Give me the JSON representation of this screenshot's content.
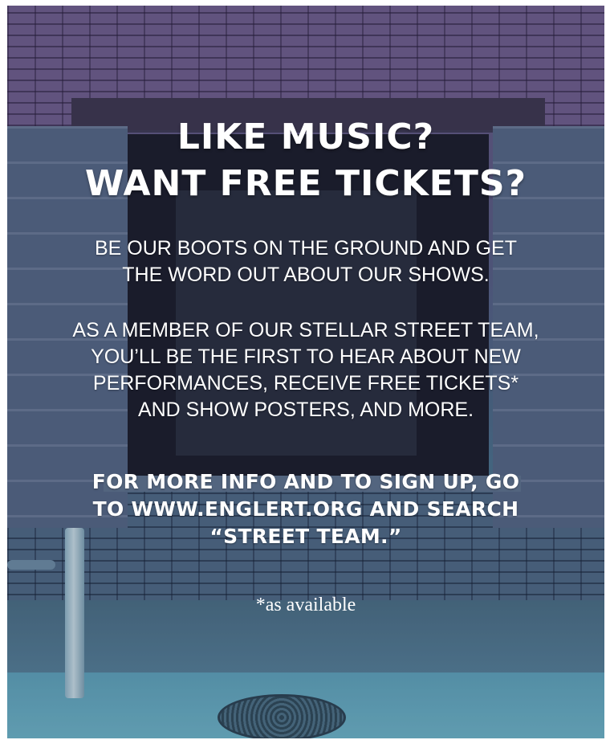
{
  "headline": {
    "line1": "LIKE MUSIC?",
    "line2": "WANT FREE TICKETS?"
  },
  "paragraph1": {
    "line1": "BE OUR BOOTS ON THE GROUND AND GET",
    "line2": "THE WORD OUT ABOUT OUR SHOWS."
  },
  "paragraph2": {
    "line1": "AS A MEMBER OF OUR STELLAR STREET TEAM,",
    "line2": "YOU’LL BE THE FIRST TO HEAR ABOUT NEW",
    "line3": "PERFORMANCES, RECEIVE FREE TICKETS*",
    "line4": "AND SHOW POSTERS, AND MORE."
  },
  "call_to_action": {
    "line1": "FOR MORE INFO AND TO SIGN UP, GO",
    "line2": "TO WWW.ENGLERT.ORG AND SEARCH",
    "line3": "“STREET TEAM.”"
  },
  "footnote": "*as available",
  "colors": {
    "text": "#ffffff",
    "tint_top": "#6a5a86",
    "tint_bottom": "#5c9db2"
  }
}
